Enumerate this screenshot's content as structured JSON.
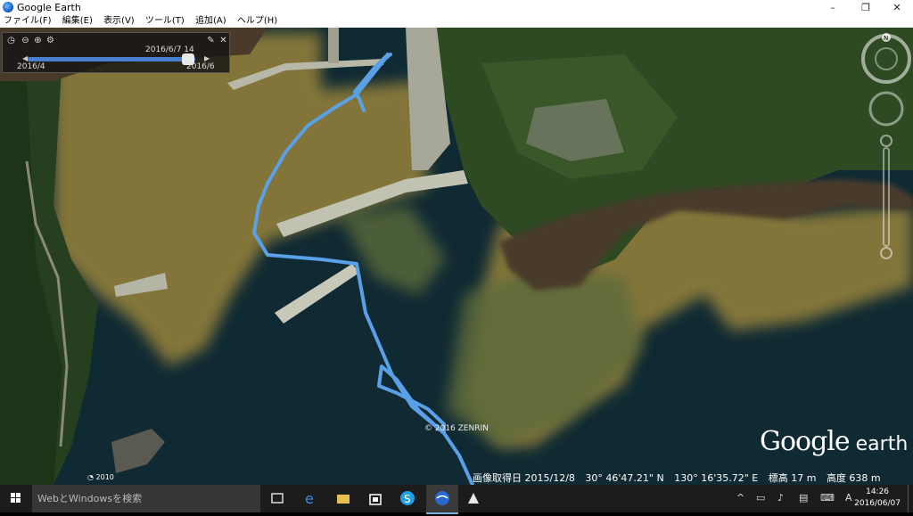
{
  "window": {
    "title": "Google Earth",
    "minimize": "–",
    "maximize": "❐",
    "close": "✕"
  },
  "menu": [
    "ファイル(F)",
    "編集(E)",
    "表示(V)",
    "ツール(T)",
    "追加(A)",
    "ヘルプ(H)"
  ],
  "time_slider": {
    "current": "2016/6/7  14",
    "start": "2016/4",
    "end": "2016/6",
    "position": 0.96
  },
  "map": {
    "copyright": "© 2016 ZENRIN",
    "logo": {
      "main": "Google",
      "suffix": " earth"
    },
    "imagery_year": "2010"
  },
  "status": {
    "imagery_date": "画像取得日  2015/12/8",
    "lat": "30°  46'47.21\" N",
    "lon": "130°  16'35.72\" E",
    "elevation": "標高   17 m",
    "altitude": "高度   638 m"
  },
  "taskbar": {
    "search_placeholder": "WebとWindowsを検索",
    "time": "14:26",
    "date": "2016/06/07",
    "ime": "A"
  },
  "colors": {
    "track": "#5aa0e6",
    "sea_dark": "#0f2a34",
    "sea_brown": "#8a7a3a",
    "land": "#2a4a20"
  }
}
